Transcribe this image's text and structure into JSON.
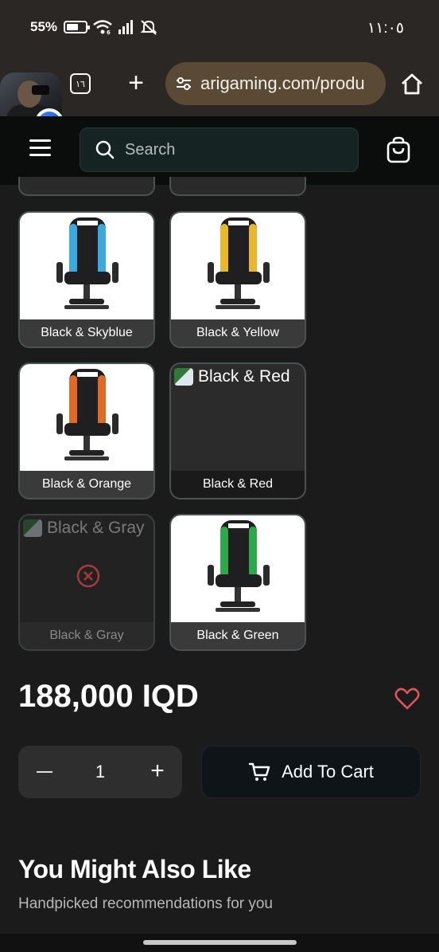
{
  "status_bar": {
    "battery": "55%",
    "battery_level": 0.55,
    "time": "١١:٠٥"
  },
  "browser": {
    "tab_count": "١٦",
    "url": "arigaming.com/produ",
    "icons": {
      "tabs": "tab-count-icon",
      "new_tab": "plus-icon",
      "site_info": "tune-icon",
      "home": "home-icon"
    }
  },
  "messenger_bubble": {
    "badge_icon": "messenger-icon"
  },
  "header": {
    "search_placeholder": "Search",
    "icons": [
      "menu-icon",
      "search-icon",
      "shopping-bag-icon"
    ]
  },
  "variants": [
    {
      "label": "Black & Skyblue",
      "accent": "#3aa9e0",
      "image": "chair",
      "state": "available"
    },
    {
      "label": "Black & Yellow",
      "accent": "#e8b72c",
      "image": "chair",
      "state": "available"
    },
    {
      "label": "Black & Orange",
      "accent": "#e06a25",
      "image": "chair",
      "state": "available"
    },
    {
      "label": "Black & Red",
      "alt_text": "Black & Red",
      "image": "broken",
      "state": "selected"
    },
    {
      "label": "Black & Gray",
      "alt_text": "Black & Gray",
      "image": "broken",
      "state": "unavailable"
    },
    {
      "label": "Black & Green",
      "accent": "#2fa84a",
      "image": "chair",
      "state": "available"
    }
  ],
  "product": {
    "price": "188,000 IQD",
    "quantity": "1",
    "add_to_cart_label": "Add To Cart"
  },
  "recommendations": {
    "title": "You Might Also Like",
    "subtitle": "Handpicked recommendations for you"
  },
  "colors": {
    "background": "#1b1b1b",
    "heart": "#e25555",
    "unavailable": "#a83a3a"
  }
}
